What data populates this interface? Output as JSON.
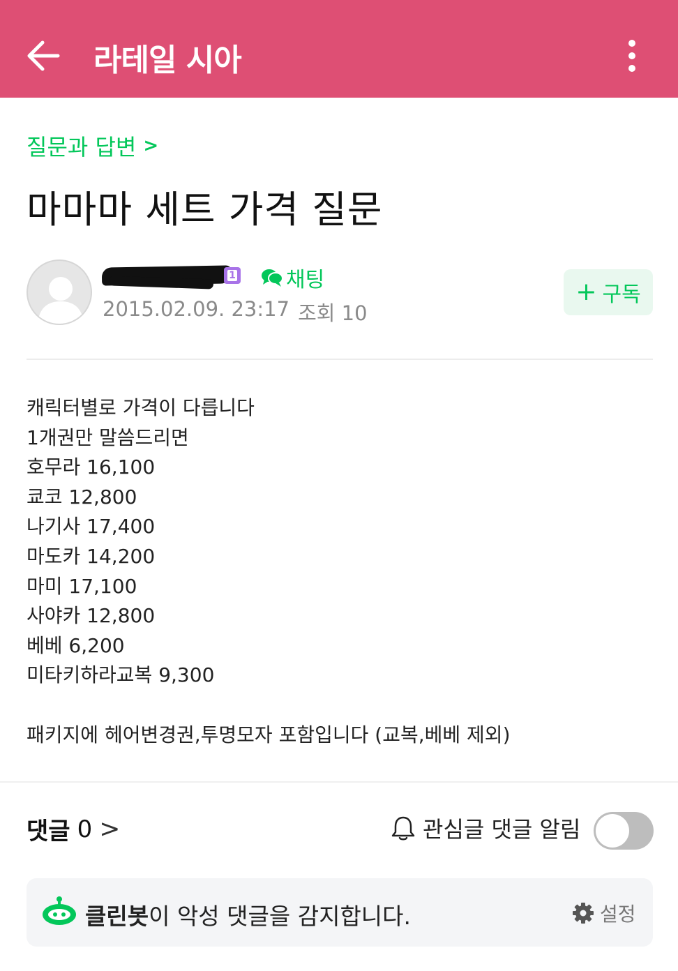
{
  "header": {
    "title": "라테일 시아",
    "back_icon": "arrow-left-icon",
    "more_icon": "more-vertical-icon",
    "background_color": "#de4f74"
  },
  "post": {
    "category": "질문과 답변",
    "title": "마마마 세트 가격 질문",
    "level_badge": "1",
    "chat_label": "채팅",
    "date": "2015.02.09. 23:17",
    "views": "조회 10",
    "subscribe_label": "구독",
    "body_lines": [
      "캐릭터별로 가격이 다릅니다",
      "1개권만 말씀드리면",
      "호무라 16,100",
      "쿄코 12,800",
      "나기사 17,400",
      "마도카 14,200",
      "마미 17,100",
      "사야카 12,800",
      "베베 6,200",
      "미타키하라교복 9,300",
      "",
      "패키지에 헤어변경권,투명모자 포함입니다 (교복,베베 제외)"
    ]
  },
  "comments": {
    "label": "댓글",
    "count": "0",
    "notify_label": "관심글 댓글 알림",
    "notify_enabled": false
  },
  "cleanbot": {
    "name": "클린봇",
    "message": "이 악성 댓글을 감지합니다.",
    "settings_label": "설정"
  },
  "colors": {
    "accent_green": "#03c75a",
    "level_badge": "#a873e8"
  }
}
